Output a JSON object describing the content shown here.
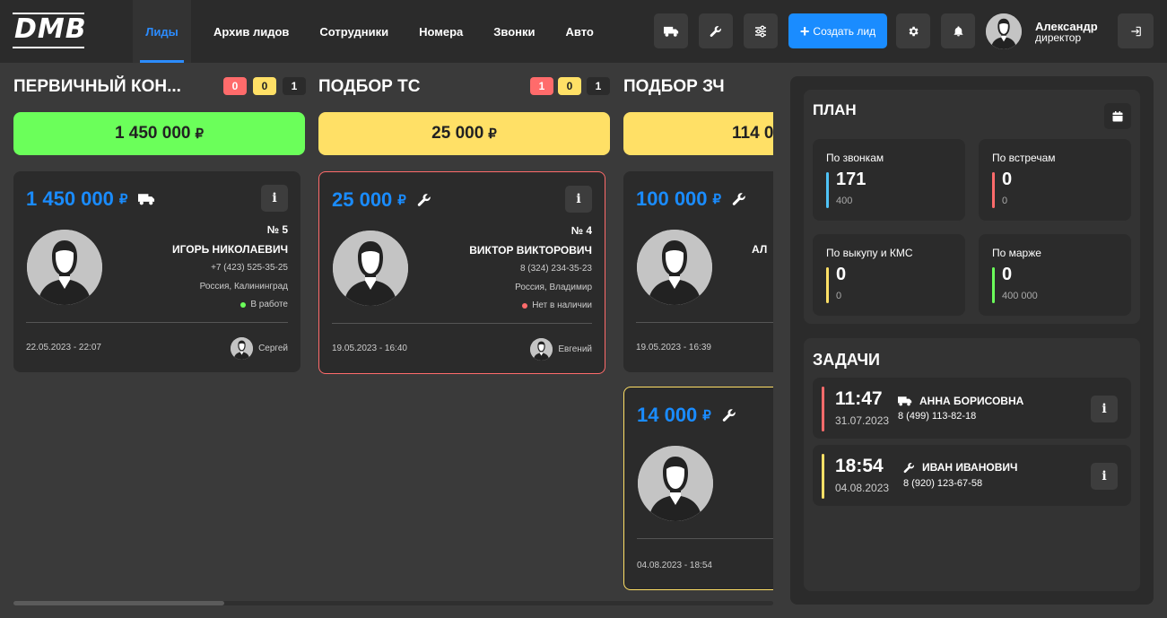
{
  "header": {
    "logo": "DMB",
    "nav": [
      "Лиды",
      "Архив лидов",
      "Сотрудники",
      "Номера",
      "Звонки",
      "Авто"
    ],
    "create_label": "Создать лид",
    "user_name": "Александр",
    "user_role": "директор"
  },
  "columns": [
    {
      "title": "ПЕРВИЧНЫЙ КОН...",
      "badges": [
        "0",
        "0",
        "1"
      ],
      "sum": "1 450 000",
      "sum_color": "#6bff5a",
      "cards": [
        {
          "amount": "1 450 000",
          "icon": "truck-icon",
          "number": "№ 5",
          "name": "ИГОРЬ НИКОЛАЕВИЧ",
          "phone": "+7 (423) 525-35-25",
          "location": "Россия, Калининград",
          "status": "В работе",
          "status_color": "#6bff5a",
          "date": "22.05.2023 - 22:07",
          "employee": "Сергей"
        }
      ]
    },
    {
      "title": "ПОДБОР ТС",
      "badges": [
        "1",
        "0",
        "1"
      ],
      "sum": "25 000",
      "sum_color": "#ffe066",
      "cards": [
        {
          "amount": "25 000",
          "icon": "wrench-icon",
          "number": "№ 4",
          "name": "ВИКТОР ВИКТОРОВИЧ",
          "phone": "8 (324) 234-35-23",
          "location": "Россия, Владимир",
          "status": "Нет в наличии",
          "status_color": "#ff6b6b",
          "date": "19.05.2023 - 16:40",
          "employee": "Евгений"
        }
      ]
    },
    {
      "title": "ПОДБОР ЗЧ",
      "sum": "114 0",
      "sum_color": "#ffe066",
      "cards": [
        {
          "amount": "100 000",
          "icon": "wrench-icon",
          "name": "АЛ",
          "date": "19.05.2023 - 16:39"
        },
        {
          "amount": "14 000",
          "icon": "wrench-icon",
          "date": "04.08.2023 - 18:54"
        }
      ]
    }
  ],
  "rub": "₽",
  "info": "i",
  "plan": {
    "title": "ПЛАН",
    "items": [
      {
        "label": "По звонкам",
        "value": "171",
        "target": "400",
        "color": "#4fc3f7"
      },
      {
        "label": "По встречам",
        "value": "0",
        "target": "0",
        "color": "#ff6b6b"
      },
      {
        "label": "По выкупу и КМС",
        "value": "0",
        "target": "0",
        "color": "#ffe066"
      },
      {
        "label": "По марже",
        "value": "0",
        "target": "400 000",
        "color": "#6bff5a"
      }
    ]
  },
  "tasks": {
    "title": "ЗАДАЧИ",
    "items": [
      {
        "time": "11:47",
        "date": "31.07.2023",
        "icon": "truck-icon",
        "name": "АННА БОРИСОВНА",
        "phone": "8 (499) 113-82-18",
        "color": "#ff6b6b"
      },
      {
        "time": "18:54",
        "date": "04.08.2023",
        "icon": "wrench-icon",
        "name": "ИВАН ИВАНОВИЧ",
        "phone": "8 (920) 123-67-58",
        "color": "#ffe066"
      }
    ]
  }
}
